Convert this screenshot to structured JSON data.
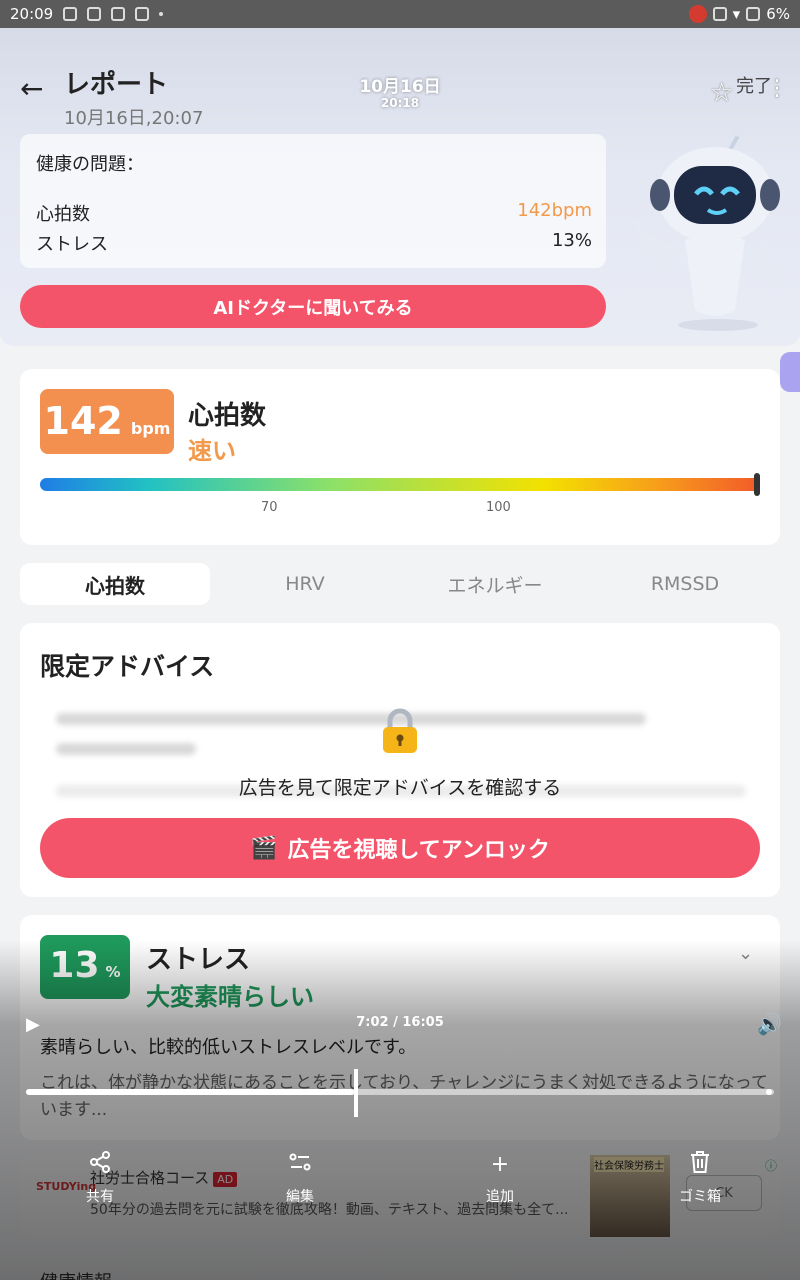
{
  "status_bar": {
    "time": "20:09",
    "battery": "6%"
  },
  "header": {
    "title": "レポート",
    "subtitle": "10月16日,20:07",
    "center_date": "10月16日",
    "center_time": "20:18",
    "done_label": "完了"
  },
  "health_issues": {
    "title": "健康の問題：",
    "rows": [
      {
        "label": "心拍数",
        "value": "142bpm"
      },
      {
        "label": "ストレス",
        "value": "13%"
      }
    ]
  },
  "ai_button": "AIドクターに聞いてみる",
  "heart_rate": {
    "value": "142",
    "unit": "bpm",
    "title": "心拍数",
    "status": "速い",
    "gauge_ticks": [
      "70",
      "100"
    ],
    "marker_value": 142
  },
  "tabs": [
    "心拍数",
    "HRV",
    "エネルギー",
    "RMSSD"
  ],
  "advice": {
    "title": "限定アドバイス",
    "locked_message": "広告を見て限定アドバイスを確認する",
    "unlock_button": "広告を視聴してアンロック"
  },
  "stress": {
    "value": "13",
    "unit": "%",
    "title": "ストレス",
    "status": "大変素晴らしい",
    "desc1": "素晴らしい、比較的低いストレスレベルです。",
    "desc2": "これは、体が静かな状態にあることを示しており、チャレンジにうまく対処できるようになっています..."
  },
  "ad": {
    "logo": "STUDYing",
    "title": "社労士合格コース",
    "badge": "AD",
    "desc": "50年分の過去問を元に試験を徹底攻略！動画、テキスト、過去問集も全て...",
    "img_label": "社会保険労務士",
    "cta": "CK"
  },
  "video": {
    "time": "7:02 / 16:05",
    "progress": 0.438
  },
  "toolbar": [
    {
      "label": "共有",
      "icon": "share-icon"
    },
    {
      "label": "編集",
      "icon": "edit-icon"
    },
    {
      "label": "追加",
      "icon": "add-icon"
    },
    {
      "label": "ゴミ箱",
      "icon": "trash-icon"
    }
  ],
  "bottom_peek": "健康情報"
}
